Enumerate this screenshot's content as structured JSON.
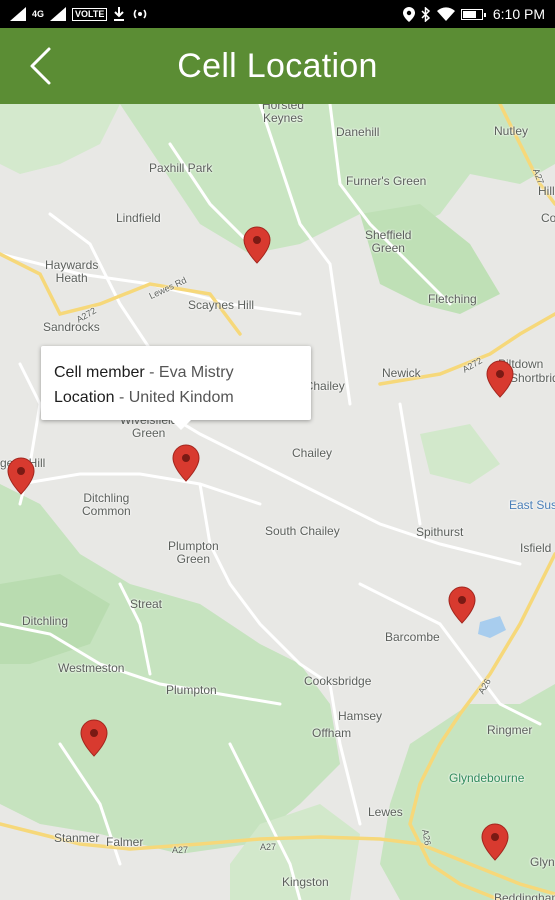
{
  "status_bar": {
    "network": "4G",
    "volte": "VOLTE",
    "time": "6:10 PM",
    "battery_level": 0.7,
    "icons": [
      "signal-icon",
      "download-icon",
      "hotspot-icon",
      "location-icon",
      "bluetooth-icon",
      "wifi-icon",
      "battery-icon"
    ]
  },
  "app_bar": {
    "title": "Cell Location",
    "back_icon": "chevron-left-icon",
    "color": "#5b8d34"
  },
  "map": {
    "places": {
      "horsted_keynes": "Horsted\nKeynes",
      "danehill": "Danehill",
      "nutley": "Nutley",
      "paxhill_park": "Paxhill Park",
      "furners_green": "Furner's Green",
      "lindfield": "Lindfield",
      "sheffield_green": "Sheffield\nGreen",
      "haywards_heath": "Haywards\nHeath",
      "scaynes_hill": "Scaynes Hill",
      "fletching": "Fletching",
      "sandrocks": "Sandrocks",
      "newick": "Newick",
      "north_chailey": "North Chailey",
      "chailey": "Chailey",
      "wivelsfield_green": "Wivelsfield\nGreen",
      "burgess_hill": "gess Hill",
      "ditchling_common": "Ditchling\nCommon",
      "east_sussex": "East Sus",
      "south_chailey": "South Chailey",
      "spithurst": "Spithurst",
      "isfield": "Isfield",
      "plumpton_green": "Plumpton\nGreen",
      "streat": "Streat",
      "barcombe": "Barcombe",
      "ditchling": "Ditchling",
      "westmeston": "Westmeston",
      "plumpton": "Plumpton",
      "cooksbridge": "Cooksbridge",
      "hamsey": "Hamsey",
      "offham": "Offham",
      "ringmer": "Ringmer",
      "glyndebourne": "Glyndebourne",
      "lewes": "Lewes",
      "stanmer": "Stanmer",
      "falmer": "Falmer",
      "kingston": "Kingston",
      "glynde": "Glyn",
      "beddingham": "Beddingham",
      "piltdown": "Piltdown",
      "shortbridge": "Shortbridg",
      "hill": "Hill",
      "co": "Co"
    },
    "roads": {
      "a27_top": "A27",
      "a272_left": "A272",
      "lewes_rd": "Lewes Rd",
      "a272_right": "A272",
      "a26": "A26",
      "a26_lower": "A26",
      "a27_bottom": "A27",
      "a27_bottom2": "A27"
    },
    "pin_color": "#d83a2f"
  },
  "info_window": {
    "member_label": "Cell member",
    "member_sep": " - ",
    "member_value": "Eva Mistry",
    "location_label": "Location",
    "location_sep": " - ",
    "location_value": "United Kindom"
  }
}
